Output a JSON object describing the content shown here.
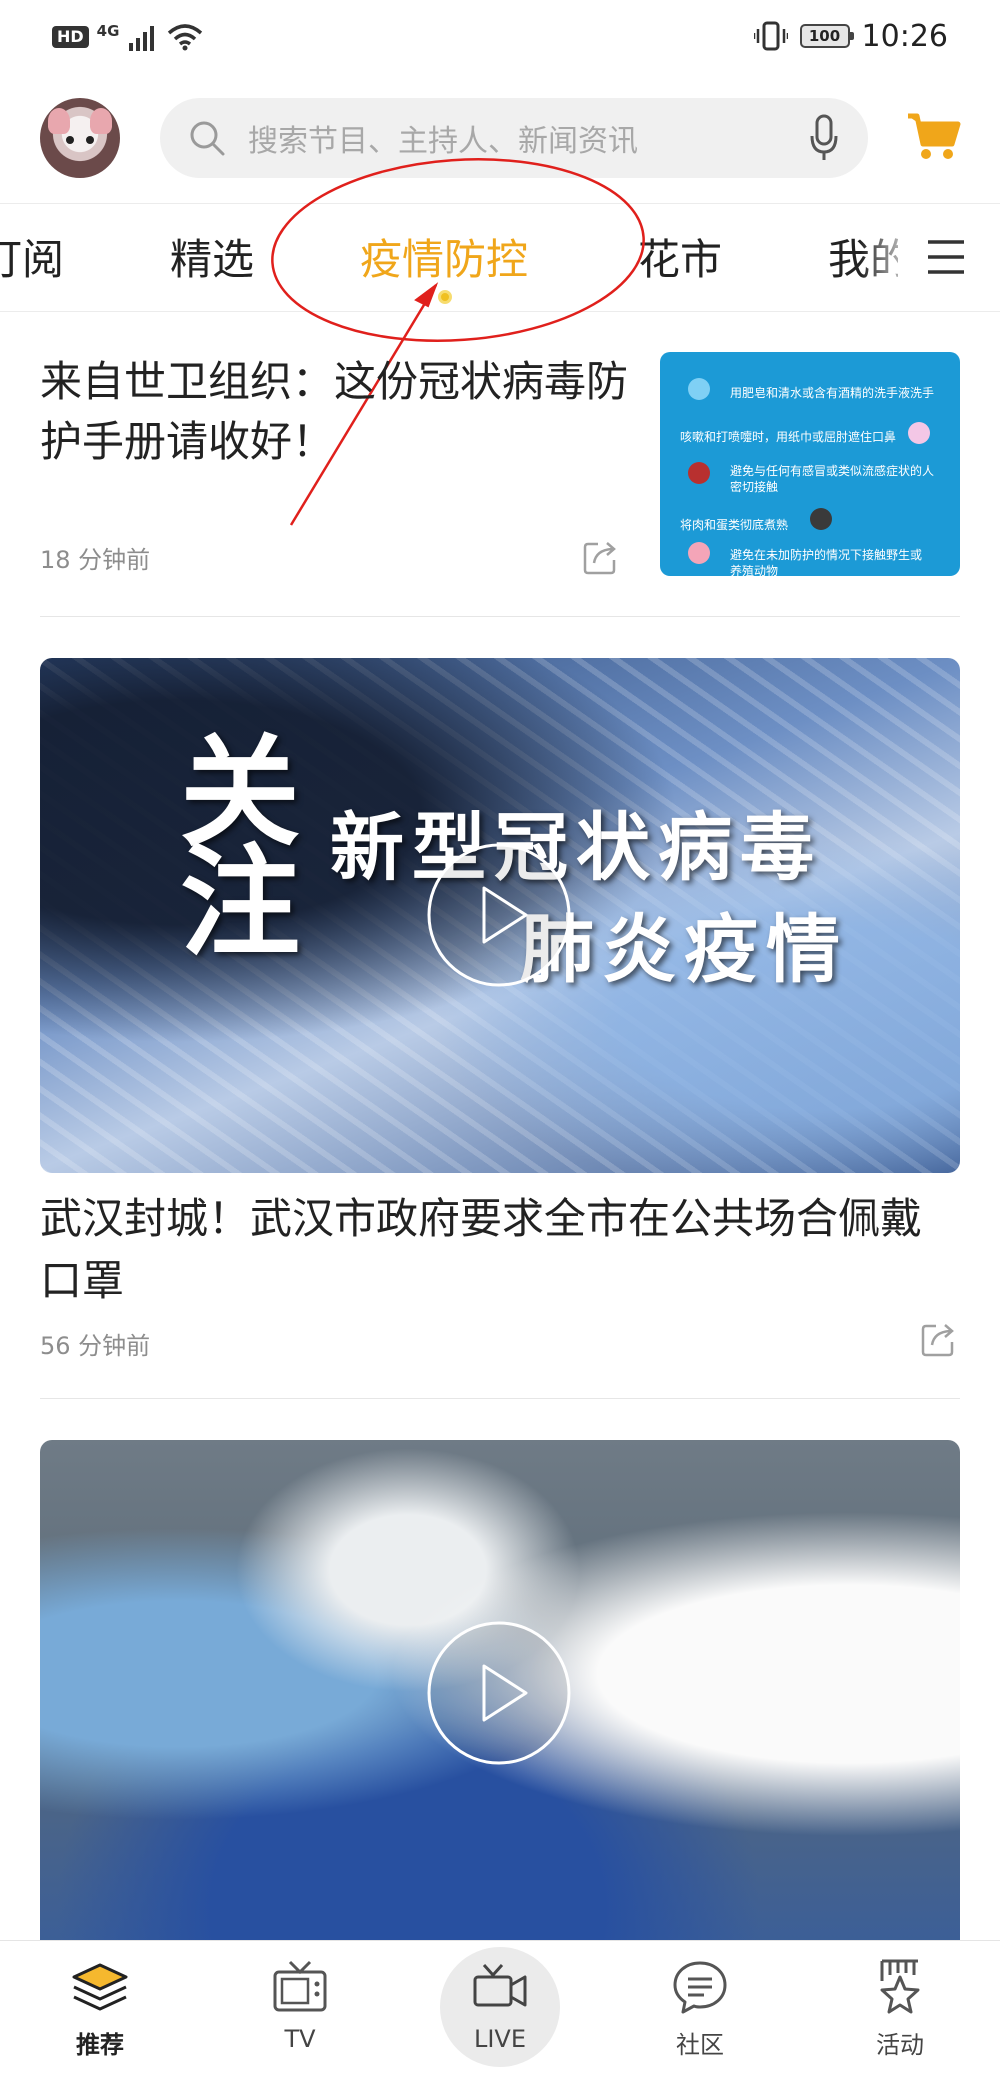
{
  "status_bar": {
    "hd": "HD",
    "network": "4G",
    "battery": "100",
    "time": "10:26"
  },
  "header": {
    "search_placeholder": "搜索节目、主持人、新闻资讯"
  },
  "tabs": [
    {
      "label": "订阅"
    },
    {
      "label": "精选"
    },
    {
      "label": "疫情防控"
    },
    {
      "label": "花市"
    },
    {
      "label": "我的"
    }
  ],
  "articles": [
    {
      "title": "来自世卫组织：这份冠状病毒防护手册请收好！",
      "time": "18 分钟前",
      "thumbnail_lines": [
        "用肥皂和清水或含有酒精的洗手液洗手",
        "咳嗽和打喷嚏时，用纸巾或屈肘遮住口鼻",
        "避免与任何有感冒或类似流感症状的人",
        "密切接触",
        "将肉和蛋类彻底煮熟",
        "避免在未加防护的情况下接触野生或",
        "养殖动物"
      ]
    },
    {
      "title": "武汉封城！武汉市政府要求全市在公共场合佩戴口罩",
      "time": "56 分钟前",
      "video_overlay": {
        "calligraphy": "关注",
        "line1": "新型冠状病毒",
        "line2": "肺炎疫情"
      }
    }
  ],
  "bottom_nav": [
    {
      "label": "推荐",
      "icon": "layers-icon"
    },
    {
      "label": "TV",
      "icon": "tv-icon"
    },
    {
      "label": "LIVE",
      "icon": "live-camera-icon"
    },
    {
      "label": "社区",
      "icon": "chat-bubble-icon"
    },
    {
      "label": "活动",
      "icon": "star-badge-icon"
    }
  ],
  "colors": {
    "accent": "#f0a61a",
    "annotation": "#e0201c",
    "thumb_bg": "#1c9ad6"
  }
}
